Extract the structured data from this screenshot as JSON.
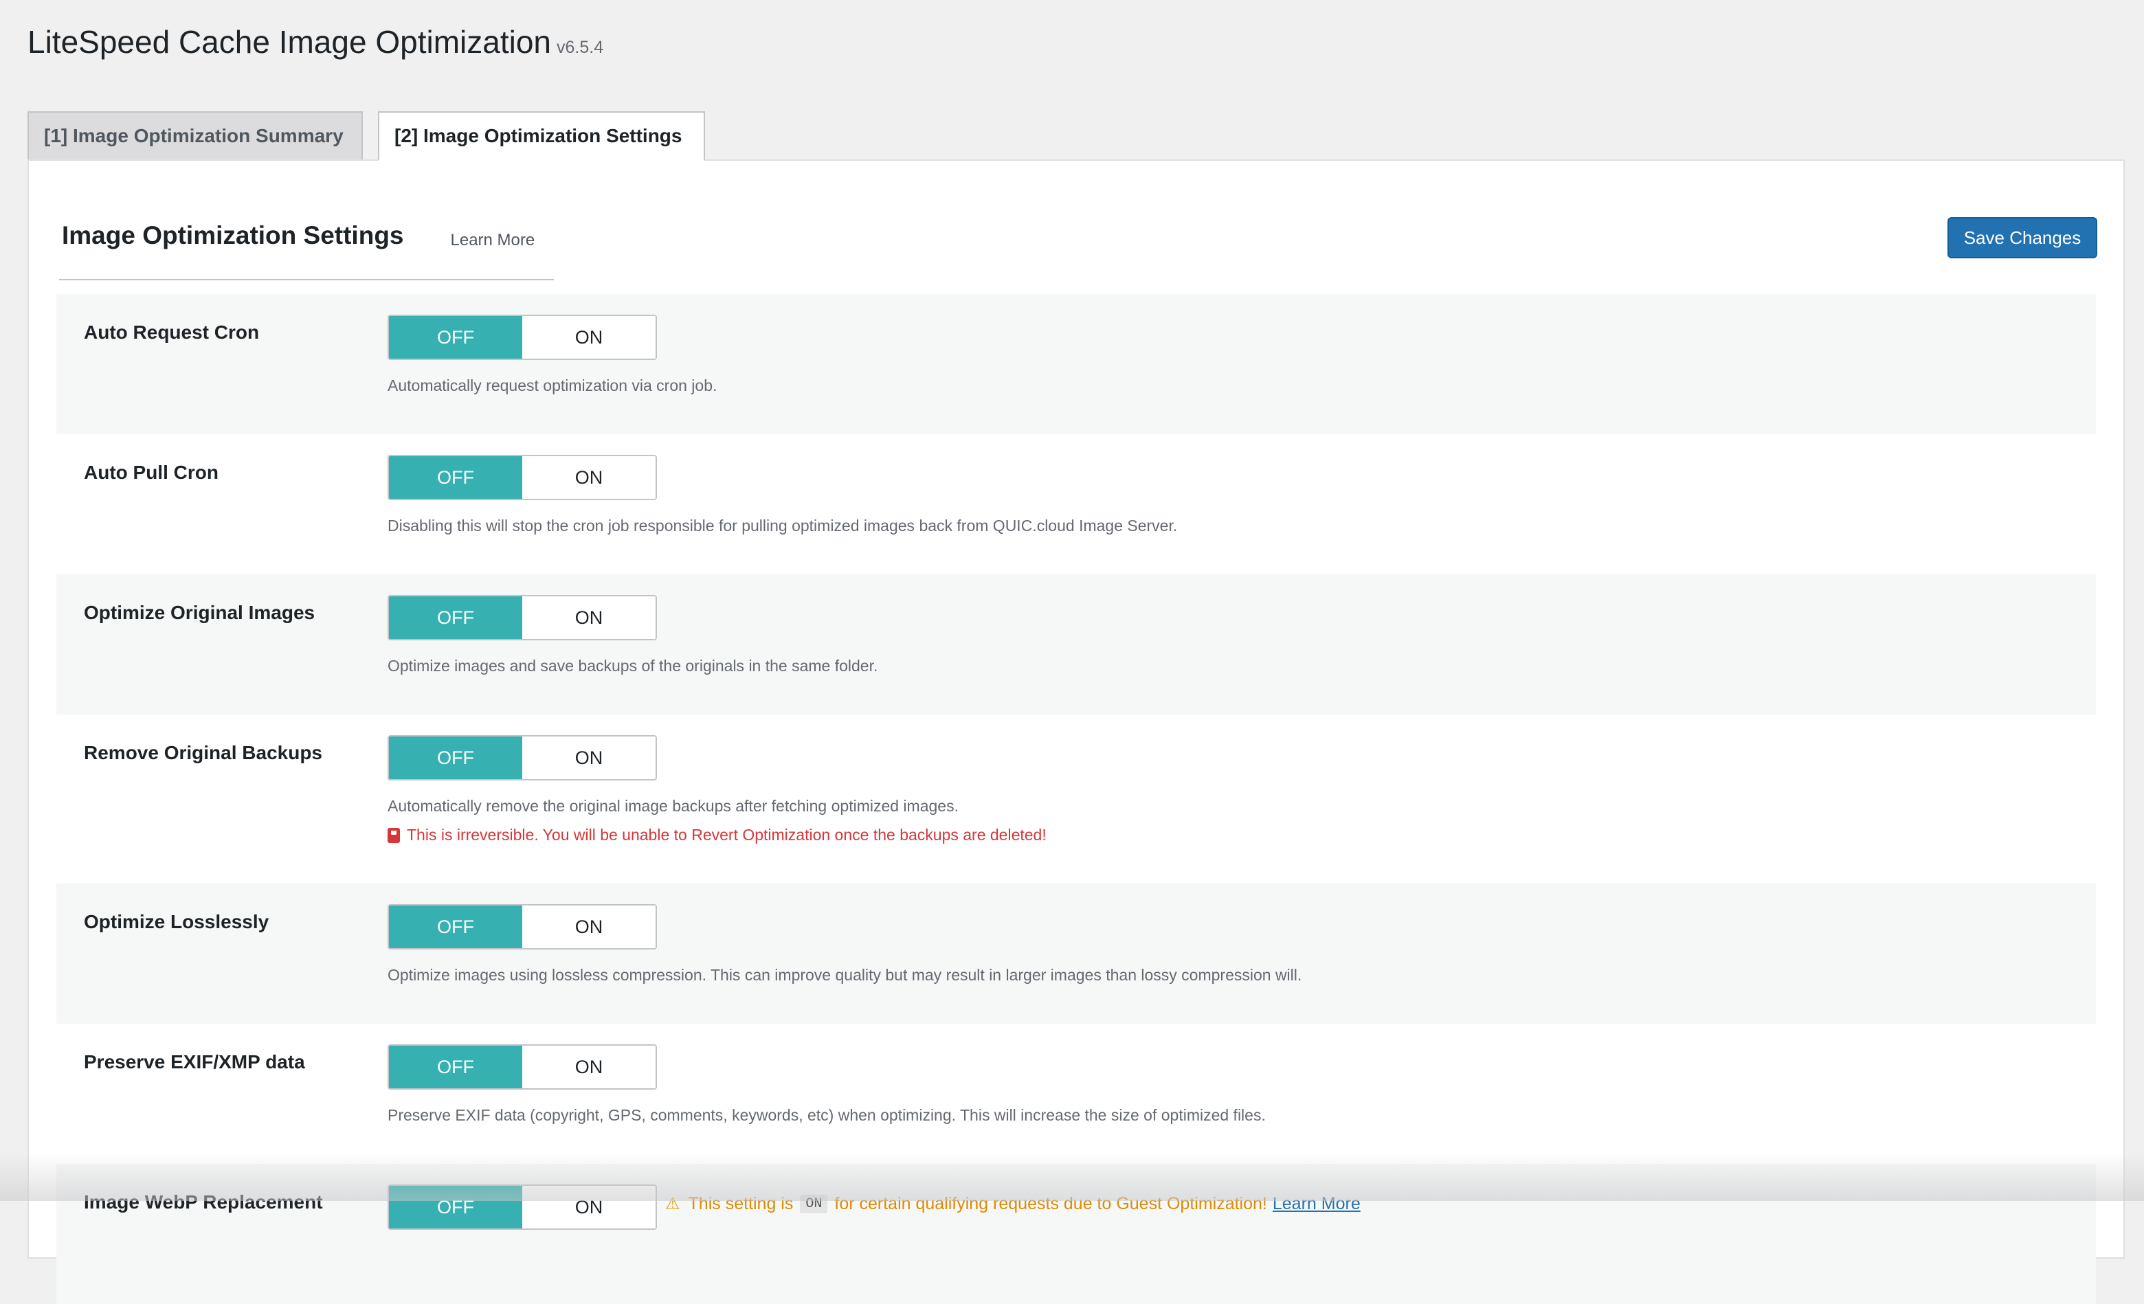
{
  "header": {
    "title": "LiteSpeed Cache Image Optimization",
    "version": "v6.5.4"
  },
  "tabs": [
    {
      "label": "[1] Image Optimization Summary",
      "active": false
    },
    {
      "label": "[2] Image Optimization Settings",
      "active": true
    }
  ],
  "section": {
    "title": "Image Optimization Settings",
    "learn_more": "Learn More",
    "save_label": "Save Changes"
  },
  "toggle_labels": {
    "off": "OFF",
    "on": "ON"
  },
  "settings": [
    {
      "label": "Auto Request Cron",
      "value": "OFF",
      "description": "Automatically request optimization via cron job."
    },
    {
      "label": "Auto Pull Cron",
      "value": "OFF",
      "description": "Disabling this will stop the cron job responsible for pulling optimized images back from QUIC.cloud Image Server."
    },
    {
      "label": "Optimize Original Images",
      "value": "OFF",
      "description": "Optimize images and save backups of the originals in the same folder."
    },
    {
      "label": "Remove Original Backups",
      "value": "OFF",
      "description": "Automatically remove the original image backups after fetching optimized images.",
      "warning": "This is irreversible. You will be unable to Revert Optimization once the backups are deleted!"
    },
    {
      "label": "Optimize Losslessly",
      "value": "OFF",
      "description": "Optimize images using lossless compression. This can improve quality but may result in larger images than lossy compression will."
    },
    {
      "label": "Preserve EXIF/XMP data",
      "value": "OFF",
      "description": "Preserve EXIF data (copyright, GPS, comments, keywords, etc) when optimizing. This will increase the size of optimized files."
    },
    {
      "label": "Image WebP Replacement",
      "value": "OFF",
      "notice": {
        "before": "This setting is",
        "code": "ON",
        "after": "for certain qualifying requests due to Guest Optimization!",
        "link": "Learn More"
      }
    }
  ],
  "colors": {
    "accent_off": "#36b0b0",
    "primary_button": "#2271b1",
    "warning_text": "#d63638",
    "notice_text": "#e08a00"
  }
}
